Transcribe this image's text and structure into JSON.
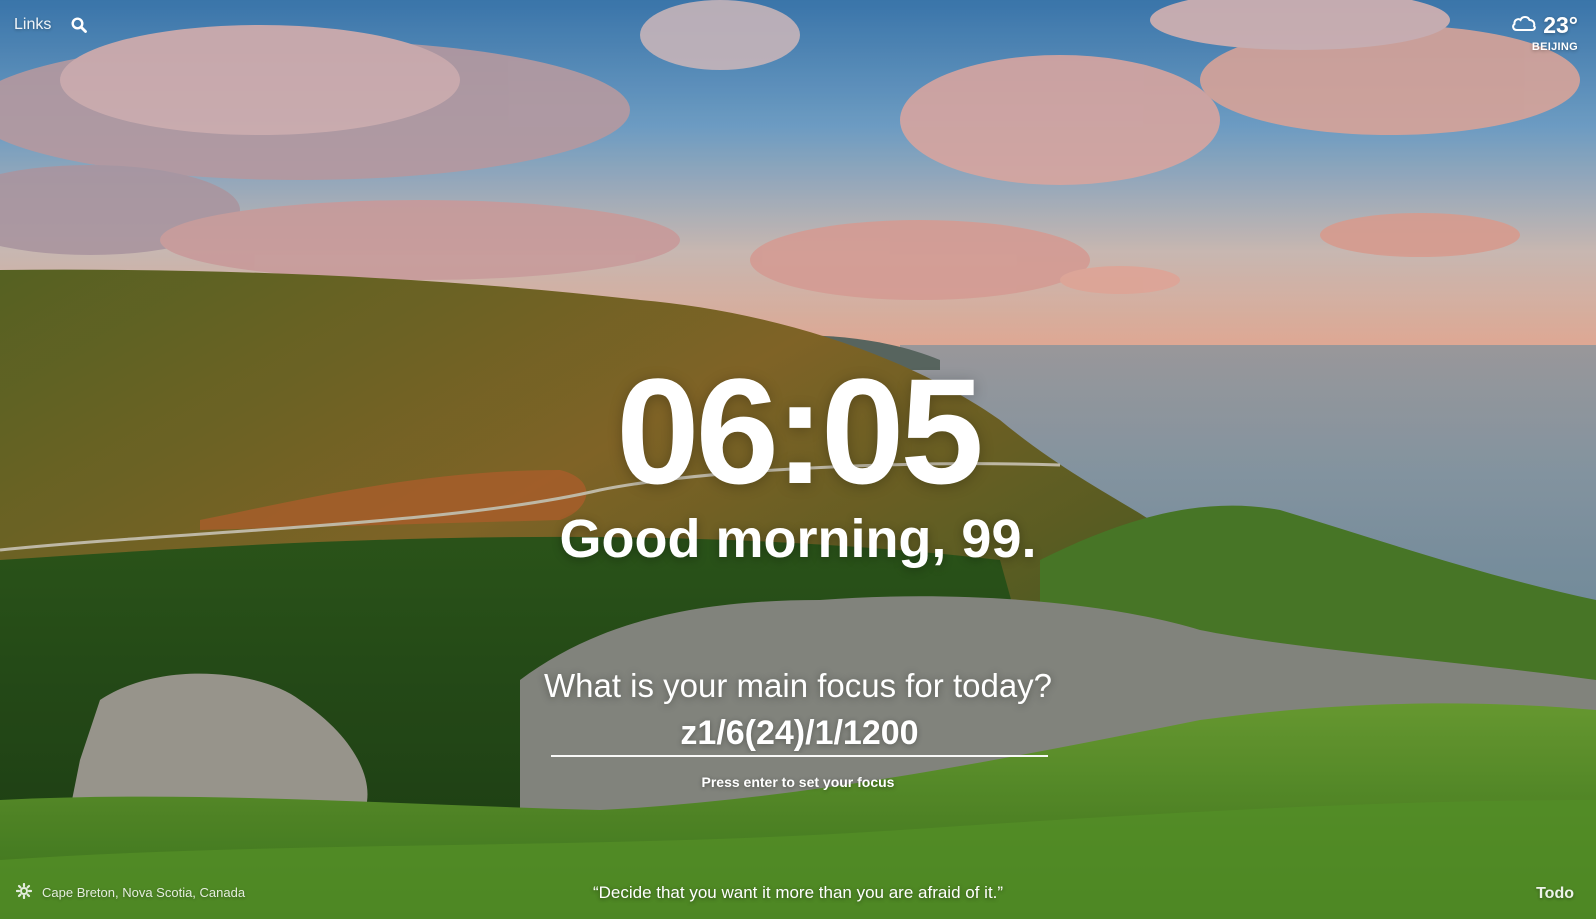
{
  "topbar": {
    "links_label": "Links",
    "search_icon": "search-icon"
  },
  "weather": {
    "icon": "cloud-icon",
    "temperature": "23°",
    "city": "BEIJING"
  },
  "clock": {
    "time": "06:05"
  },
  "greeting": {
    "text": "Good morning, 99."
  },
  "focus": {
    "question": "What is your main focus for today?",
    "value": "z1/6(24)/1/1200",
    "hint": "Press enter to set your focus"
  },
  "footer": {
    "settings_icon": "gear-icon",
    "photo_location": "Cape Breton, Nova Scotia, Canada",
    "quote": "“Decide that you want it more than you are afraid of it.”",
    "todo_label": "Todo"
  },
  "colors": {
    "text": "#ffffff",
    "sky_top": "#4f8fc4",
    "sky_horizon": "#f3b59a",
    "sea": "#7f99ab",
    "hills": "#3c5f22",
    "grass": "#6ca833"
  }
}
